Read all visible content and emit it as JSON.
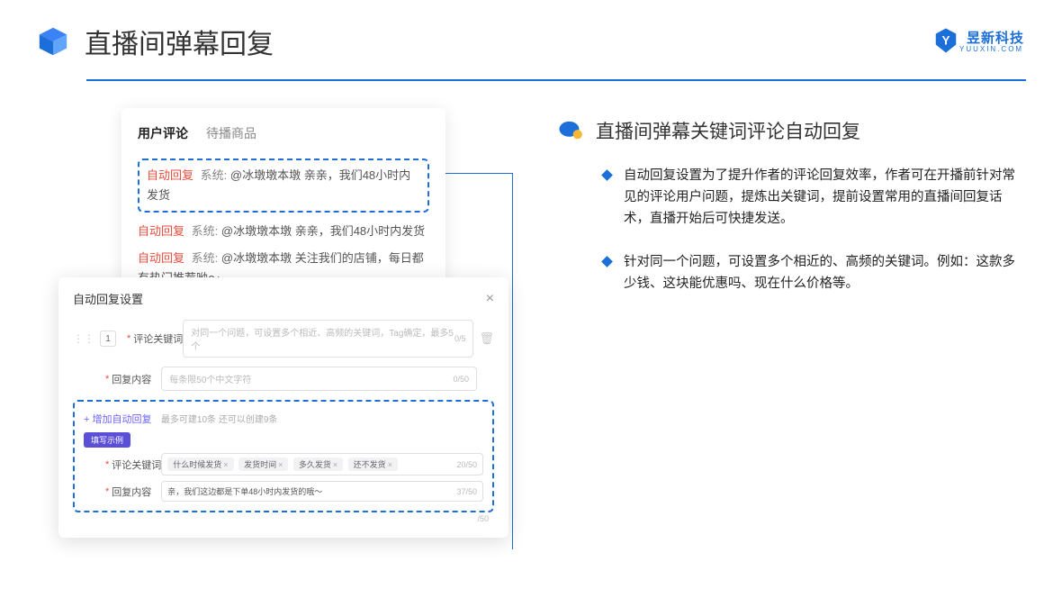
{
  "header": {
    "title": "直播间弹幕回复",
    "brand_name": "昱新科技",
    "brand_sub": "YUUXIN.COM"
  },
  "reviewPanel": {
    "tabs": [
      "用户评论",
      "待播商品"
    ],
    "highlighted": {
      "badge": "自动回复",
      "sys": "系统:",
      "text": "@冰墩墩本墩 亲亲，我们48小时内发货"
    },
    "lines": [
      {
        "badge": "自动回复",
        "sys": "系统:",
        "text": "@冰墩墩本墩 亲亲，我们48小时内发货"
      },
      {
        "badge": "自动回复",
        "sys": "系统:",
        "text": "@冰墩墩本墩 关注我们的店铺，每日都有热门推荐呦～"
      }
    ]
  },
  "settings": {
    "title": "自动回复设置",
    "rowNum": "1",
    "keywordLabel": "评论关键词",
    "keywordPlaceholder": "对同一个问题，可设置多个相近、高频的关键词，Tag确定，最多5个",
    "keywordCounter": "0/5",
    "contentLabel": "回复内容",
    "contentPlaceholder": "每条限50个中文字符",
    "contentCounter": "0/50",
    "addLink": "+ 增加自动回复",
    "addCaption": "最多可建10条 还可以创建9条",
    "pill": "填写示例",
    "example": {
      "keywordLabel": "评论关键词",
      "tags": [
        "什么时候发货",
        "发货时间",
        "多久发货",
        "还不发货"
      ],
      "keywordCounter": "20/50",
      "contentLabel": "回复内容",
      "contentText": "亲，我们这边都是下单48小时内发货的哦～",
      "contentCounter": "37/50",
      "trailCounter": "/50"
    }
  },
  "right": {
    "title": "直播间弹幕关键词评论自动回复",
    "bullets": [
      "自动回复设置为了提升作者的评论回复效率，作者可在开播前针对常见的评论用户问题，提炼出关键词，提前设置常用的直播间回复话术，直播开始后可快捷发送。",
      "针对同一个问题，可设置多个相近的、高频的关键词。例如：这款多少钱、这块能优惠吗、现在什么价格等。"
    ]
  }
}
